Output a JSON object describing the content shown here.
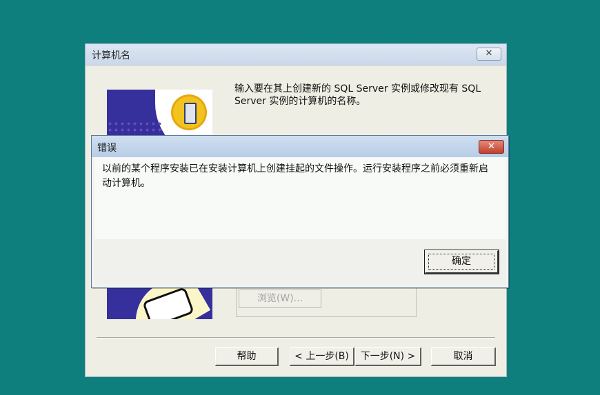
{
  "wizard": {
    "title": "计算机名",
    "close_label": "✕",
    "description": "输入要在其上创建新的 SQL Server 实例或修改现有 SQL Server 实例的计算机的名称。",
    "browse_label": "浏览(W)...",
    "buttons": {
      "help": "帮助",
      "back": "< 上一步(B)",
      "next": "下一步(N) >",
      "cancel": "取消"
    }
  },
  "error_dialog": {
    "title": "错误",
    "close_label": "✕",
    "message": "以前的某个程序安装已在安装计算机上创建挂起的文件操作。运行安装程序之前必须重新启动计算机。",
    "ok_label": "确定"
  },
  "colors": {
    "desktop": "#0f7f7e",
    "art_blue": "#36309c",
    "close_red": "#c2402b"
  }
}
